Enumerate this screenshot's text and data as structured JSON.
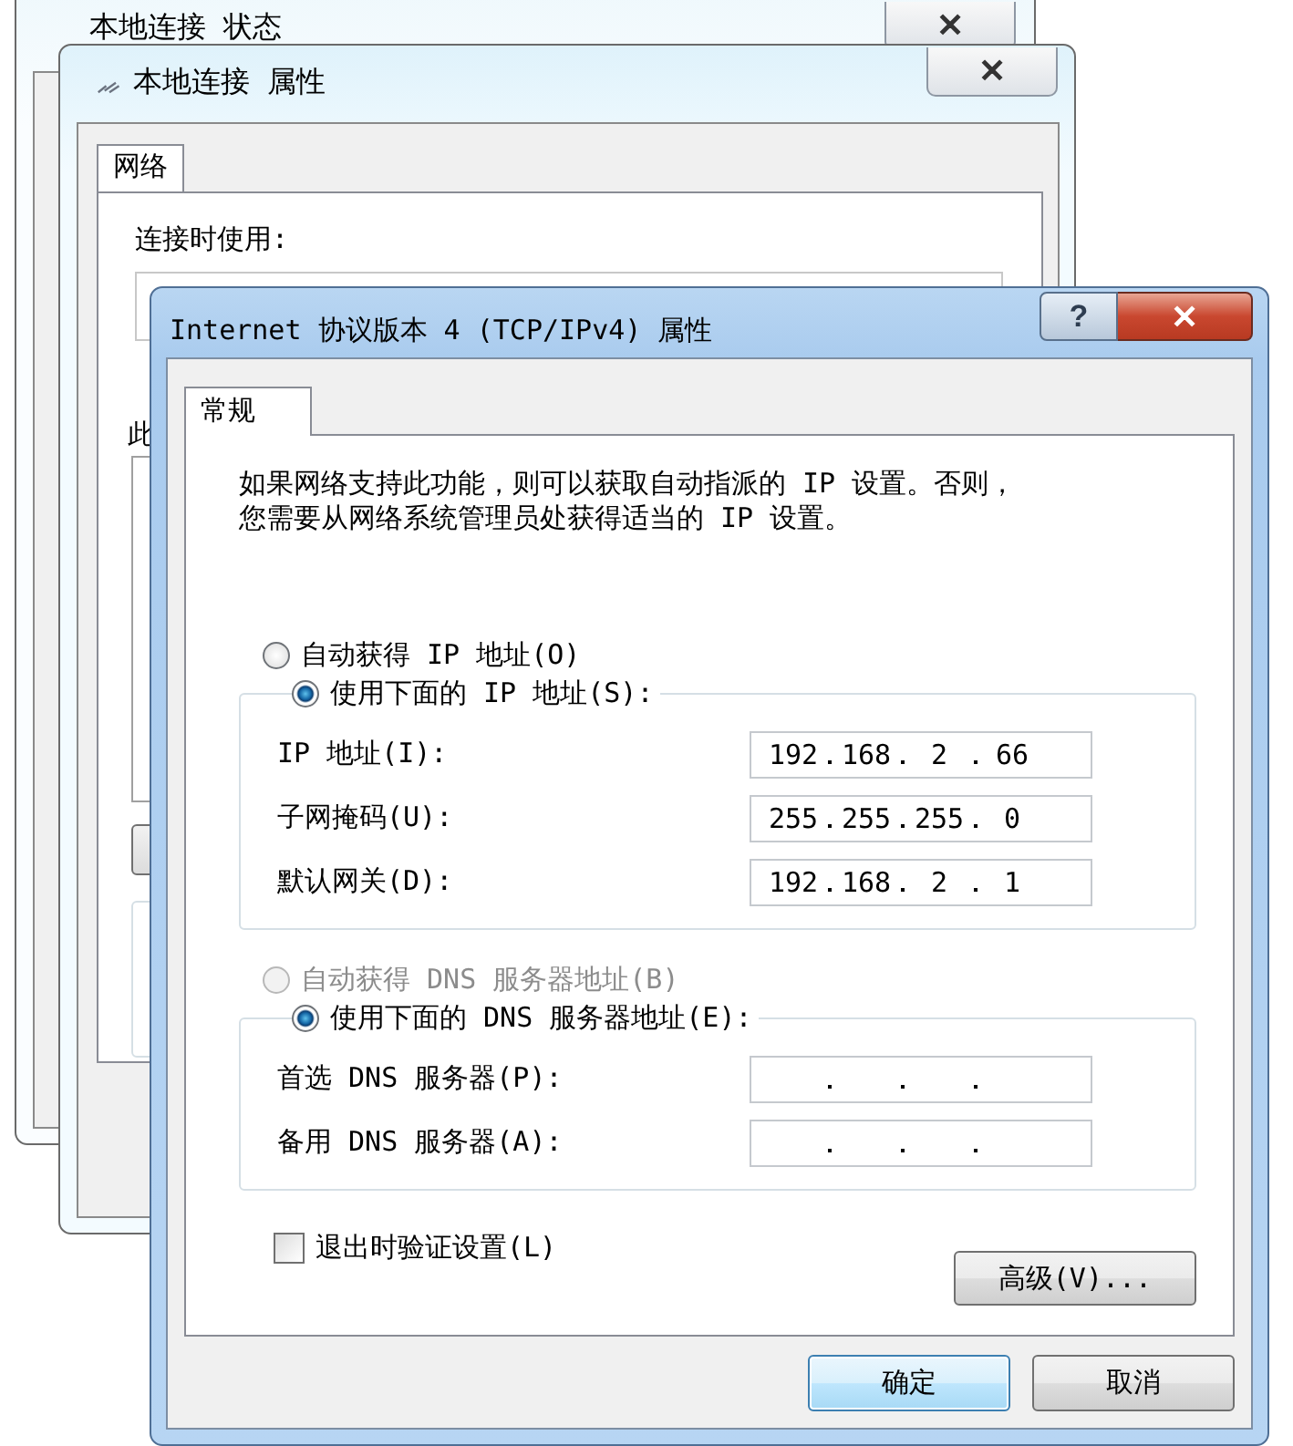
{
  "status_window": {
    "title": "本地连接 状态",
    "close": "✕"
  },
  "properties_window": {
    "title": "本地连接 属性",
    "close": "✕",
    "tabs": [
      {
        "label": "网络",
        "selected": true
      }
    ],
    "connect_using_label": "连接时使用:",
    "list_label": "此"
  },
  "ipv4_window": {
    "title": "Internet 协议版本 4 (TCP/IPv4) 属性",
    "help": "?",
    "close": "✕",
    "tabs": [
      {
        "label": "常规",
        "selected": true
      }
    ],
    "intro": [
      "如果网络支持此功能，则可以获取自动指派的 IP 设置。否则，",
      "您需要从网络系统管理员处获得适当的 IP 设置。"
    ],
    "ip_options": [
      {
        "label": "自动获得 IP 地址(O)",
        "selected": false,
        "disabled": false
      },
      {
        "label": "使用下面的 IP 地址(S):",
        "selected": true,
        "disabled": false
      }
    ],
    "ip_fields": [
      {
        "label": "IP 地址(I):",
        "octets": [
          "192",
          "168",
          "2",
          "66"
        ]
      },
      {
        "label": "子网掩码(U):",
        "octets": [
          "255",
          "255",
          "255",
          "0"
        ]
      },
      {
        "label": "默认网关(D):",
        "octets": [
          "192",
          "168",
          "2",
          "1"
        ]
      }
    ],
    "dns_options": [
      {
        "label": "自动获得 DNS 服务器地址(B)",
        "selected": false,
        "disabled": true
      },
      {
        "label": "使用下面的 DNS 服务器地址(E):",
        "selected": true,
        "disabled": false
      }
    ],
    "dns_fields": [
      {
        "label": "首选 DNS 服务器(P):"
      },
      {
        "label": "备用 DNS 服务器(A):"
      }
    ],
    "validate_checkbox": {
      "label": "退出时验证设置(L)",
      "checked": false
    },
    "advanced_button": "高级(V)...",
    "buttons": [
      {
        "label": "确定",
        "default": true
      },
      {
        "label": "取消",
        "default": false
      }
    ]
  }
}
